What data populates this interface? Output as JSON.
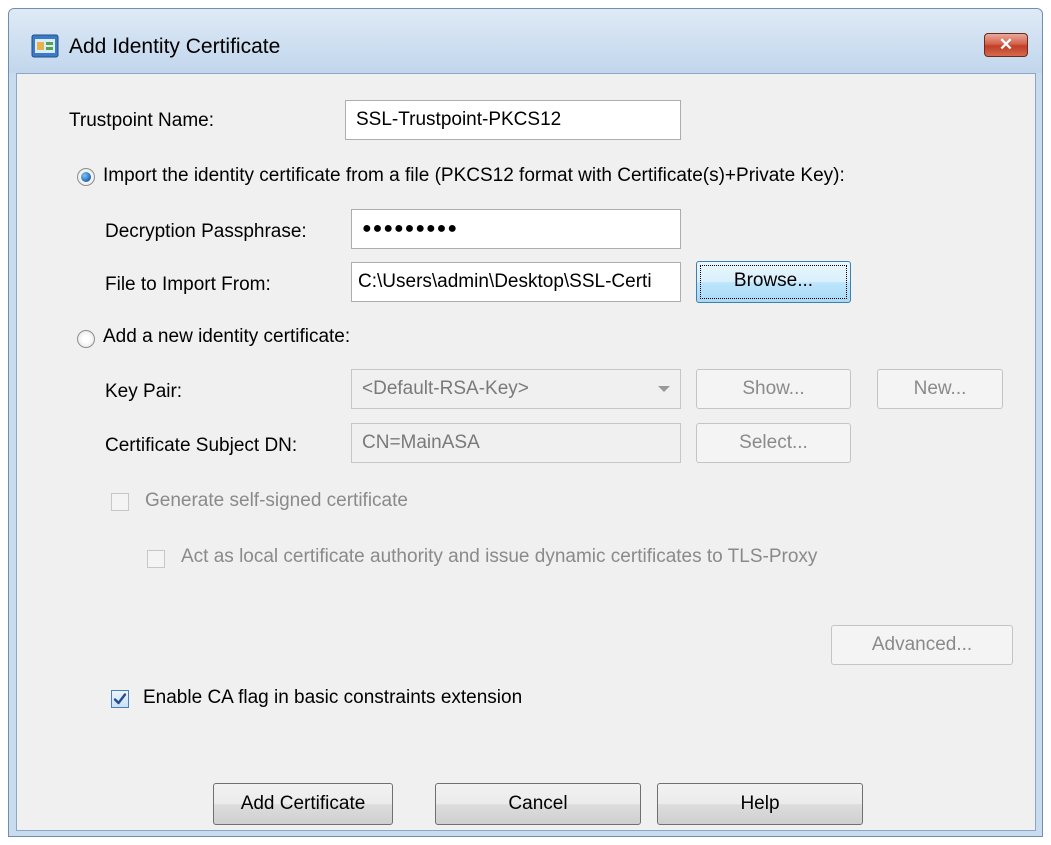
{
  "window": {
    "title": "Add Identity Certificate",
    "close_symbol": "✕"
  },
  "trustpoint": {
    "label": "Trustpoint Name:",
    "value": "SSL-Trustpoint-PKCS12"
  },
  "import_option": {
    "label": "Import the identity certificate from a file (PKCS12 format with Certificate(s)+Private Key):",
    "selected": true,
    "passphrase_label": "Decryption Passphrase:",
    "passphrase_value": "●●●●●●●●●",
    "file_label": "File to Import From:",
    "file_value": "C:\\Users\\admin\\Desktop\\SSL-Certi",
    "browse_button": "Browse..."
  },
  "new_option": {
    "label": "Add a new identity certificate:",
    "selected": false,
    "key_pair_label": "Key Pair:",
    "key_pair_value": "<Default-RSA-Key>",
    "show_button": "Show...",
    "new_button": "New...",
    "subject_label": "Certificate Subject DN:",
    "subject_value": "CN=MainASA",
    "select_button": "Select...",
    "self_signed_label": "Generate self-signed certificate",
    "local_ca_label": "Act as local certificate authority and issue dynamic certificates to TLS-Proxy",
    "advanced_button": "Advanced..."
  },
  "ca_flag": {
    "label": "Enable CA flag in basic constraints extension",
    "checked": true
  },
  "footer": {
    "add_button": "Add Certificate",
    "cancel_button": "Cancel",
    "help_button": "Help"
  },
  "colors": {
    "title_bar": "#c9dcef",
    "dialog_bg": "#f0f0f0",
    "close_button": "#c33d26",
    "focus_button": "#bee6fd"
  }
}
